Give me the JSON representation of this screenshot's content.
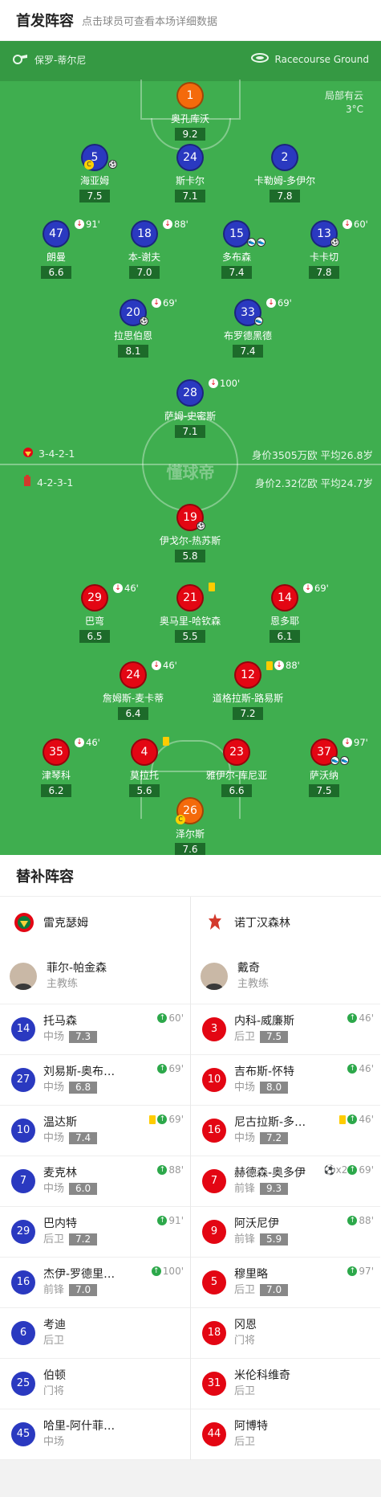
{
  "header": {
    "title": "首发阵容",
    "subtitle": "点击球员可查看本场详细数据"
  },
  "match_info": {
    "referee": "保罗-蒂尔尼",
    "venue": "Racecourse Ground",
    "weather": "局部有云",
    "temperature": "3°C"
  },
  "colors": {
    "pitch": "#3fae4f",
    "home_kit": "#2a39c0",
    "away_kit": "#e30613",
    "keeper": "#f46a0b"
  },
  "home_team": {
    "formation": "3-4-2-1",
    "value_text": "身价3505万欧  平均26.8岁",
    "players": [
      {
        "num": "1",
        "name": "奥孔库沃",
        "rating": "9.2"
      },
      {
        "num": "5",
        "name": "海亚姆",
        "rating": "7.5"
      },
      {
        "num": "24",
        "name": "斯卡尔",
        "rating": "7.1"
      },
      {
        "num": "2",
        "name": "卡勒姆-多伊尔",
        "rating": "7.8"
      },
      {
        "num": "47",
        "name": "朗曼",
        "rating": "6.6",
        "sub": "91'"
      },
      {
        "num": "18",
        "name": "本-谢夫",
        "rating": "7.0",
        "sub": "88'"
      },
      {
        "num": "15",
        "name": "多布森",
        "rating": "7.4"
      },
      {
        "num": "13",
        "name": "卡卡切",
        "rating": "7.8",
        "sub": "60'"
      },
      {
        "num": "20",
        "name": "拉思伯恩",
        "rating": "8.1",
        "sub": "69'"
      },
      {
        "num": "33",
        "name": "布罗德黑德",
        "rating": "7.4",
        "sub": "69'"
      },
      {
        "num": "28",
        "name": "萨姆-史密斯",
        "rating": "7.1",
        "sub": "100'"
      }
    ]
  },
  "away_team": {
    "formation": "4-2-3-1",
    "value_text": "身价2.32亿欧  平均24.7岁",
    "players": [
      {
        "num": "19",
        "name": "伊戈尔-热苏斯",
        "rating": "5.8"
      },
      {
        "num": "29",
        "name": "巴弯",
        "rating": "6.5",
        "sub": "46'"
      },
      {
        "num": "21",
        "name": "奥马里-哈钦森",
        "rating": "5.5"
      },
      {
        "num": "14",
        "name": "恩多耶",
        "rating": "6.1",
        "sub": "69'"
      },
      {
        "num": "24",
        "name": "詹姆斯-麦卡蒂",
        "rating": "6.4",
        "sub": "46'"
      },
      {
        "num": "12",
        "name": "道格拉斯-路易斯",
        "rating": "7.2",
        "sub": "88'"
      },
      {
        "num": "35",
        "name": "津琴科",
        "rating": "6.2",
        "sub": "46'"
      },
      {
        "num": "4",
        "name": "莫拉托",
        "rating": "5.6"
      },
      {
        "num": "23",
        "name": "雅伊尔-库尼亚",
        "rating": "6.6"
      },
      {
        "num": "37",
        "name": "萨沃纳",
        "rating": "7.5",
        "sub": "97'"
      },
      {
        "num": "26",
        "name": "泽尔斯",
        "rating": "7.6"
      }
    ]
  },
  "watermark": "懂球帝",
  "subs": {
    "title": "替补阵容",
    "home_name": "雷克瑟姆",
    "away_name": "诺丁汉森林",
    "home_coach": {
      "name": "菲尔-帕金森",
      "role": "主教练"
    },
    "away_coach": {
      "name": "戴奇",
      "role": "主教练"
    },
    "home": [
      {
        "num": "14",
        "name": "托马森",
        "pos": "中场",
        "rating": "7.3",
        "ev": "60'"
      },
      {
        "num": "27",
        "name": "刘易斯-奥布赖恩",
        "pos": "中场",
        "rating": "6.8",
        "ev": "69'"
      },
      {
        "num": "10",
        "name": "温达斯",
        "pos": "中场",
        "rating": "7.4",
        "ev": "69'"
      },
      {
        "num": "7",
        "name": "麦克林",
        "pos": "中场",
        "rating": "6.0",
        "ev": "88'"
      },
      {
        "num": "29",
        "name": "巴内特",
        "pos": "后卫",
        "rating": "7.2",
        "ev": "91'"
      },
      {
        "num": "16",
        "name": "杰伊-罗德里格斯",
        "pos": "前锋",
        "rating": "7.0",
        "ev": "100'"
      },
      {
        "num": "6",
        "name": "考迪",
        "pos": "后卫",
        "rating": "",
        "ev": ""
      },
      {
        "num": "25",
        "name": "伯顿",
        "pos": "门将",
        "rating": "",
        "ev": ""
      },
      {
        "num": "45",
        "name": "哈里-阿什菲尔德",
        "pos": "中场",
        "rating": "",
        "ev": ""
      }
    ],
    "away": [
      {
        "num": "3",
        "name": "内科-威廉斯",
        "pos": "后卫",
        "rating": "7.5",
        "ev": "46'"
      },
      {
        "num": "10",
        "name": "吉布斯-怀特",
        "pos": "中场",
        "rating": "8.0",
        "ev": "46'"
      },
      {
        "num": "16",
        "name": "尼古拉斯-多明格斯",
        "pos": "中场",
        "rating": "7.2",
        "ev": "46'"
      },
      {
        "num": "7",
        "name": "赫德森-奥多伊",
        "pos": "前锋",
        "rating": "9.3",
        "ev": "69'",
        "goals": "x2"
      },
      {
        "num": "9",
        "name": "阿沃尼伊",
        "pos": "前锋",
        "rating": "5.9",
        "ev": "88'"
      },
      {
        "num": "5",
        "name": "穆里略",
        "pos": "后卫",
        "rating": "7.0",
        "ev": "97'"
      },
      {
        "num": "18",
        "name": "冈恩",
        "pos": "门将",
        "rating": "",
        "ev": ""
      },
      {
        "num": "31",
        "name": "米伦科维奇",
        "pos": "后卫",
        "rating": "",
        "ev": ""
      },
      {
        "num": "44",
        "name": "阿博特",
        "pos": "后卫",
        "rating": "",
        "ev": ""
      }
    ]
  }
}
